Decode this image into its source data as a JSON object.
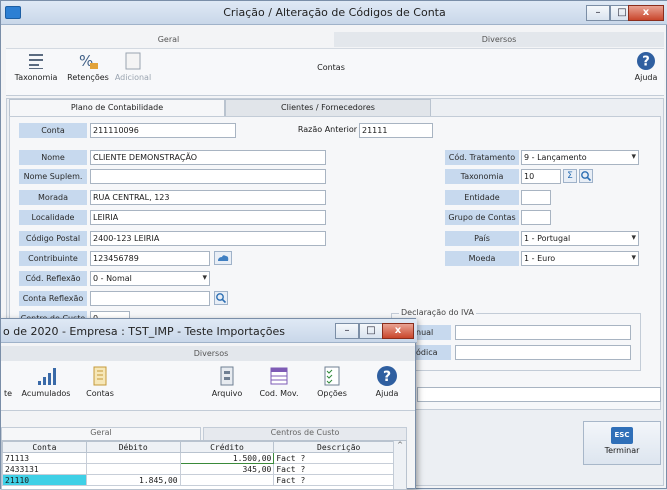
{
  "main_window": {
    "title": "Criação / Alteração de Códigos de Conta",
    "buttons": {
      "minimize": "–",
      "maximize": "□",
      "close": "x"
    },
    "ribbon_tabs": [
      "Geral",
      "Diversos"
    ],
    "ribbon_buttons": [
      {
        "label": "Taxonomia",
        "icon": "list-icon"
      },
      {
        "label": "Retenções",
        "icon": "percent-icon"
      },
      {
        "label": "Adicional",
        "icon": "blank-doc-icon"
      }
    ],
    "ribbon_center_label": "Contas",
    "help_label": "Ajuda",
    "tabs": [
      "Plano de Contabilidade",
      "Clientes / Fornecedores"
    ],
    "fields": {
      "conta": {
        "label": "Conta",
        "value": "211110096"
      },
      "razao_anterior": {
        "label": "Razão Anterior",
        "value": "21111"
      },
      "nome": {
        "label": "Nome",
        "value": "CLIENTE DEMONSTRAÇÃO"
      },
      "nome_suplem": {
        "label": "Nome Suplem.",
        "value": ""
      },
      "morada": {
        "label": "Morada",
        "value": "RUA CENTRAL, 123"
      },
      "localidade": {
        "label": "Localidade",
        "value": "LEIRIA"
      },
      "codigo_postal": {
        "label": "Código Postal",
        "value": "2400-123 LEIRIA"
      },
      "contribuinte": {
        "label": "Contribuinte",
        "value": "123456789"
      },
      "cod_reflexao": {
        "label": "Cód. Reflexão",
        "value": "0 - Nomal"
      },
      "conta_reflexao": {
        "label": "Conta Reflexão",
        "value": ""
      },
      "centro_custo": {
        "label": "Centro de Custo",
        "value": "0"
      },
      "cod_tratamento": {
        "label": "Cód. Tratamento",
        "value": "9 - Lançamento"
      },
      "taxonomia": {
        "label": "Taxonomia",
        "value": "10"
      },
      "entidade": {
        "label": "Entidade",
        "value": ""
      },
      "grupo_contas": {
        "label": "Grupo de Contas",
        "value": ""
      },
      "pais": {
        "label": "País",
        "value": "1 - Portugal"
      },
      "moeda": {
        "label": "Moeda",
        "value": "1 - Euro"
      }
    },
    "iva_group": {
      "title": "Declaração do IVA",
      "mensal": "nual",
      "periodica": "ódica"
    },
    "terminar": {
      "key": "ESC",
      "label": "Terminar"
    }
  },
  "secondary_window": {
    "title": "o de 2020 - Empresa : TST_IMP - Teste Importações",
    "ribbon_tab": "Diversos",
    "buttons": [
      {
        "label": "te",
        "icon": "partial-icon"
      },
      {
        "label": "Acumulados",
        "icon": "bar-chart-icon"
      },
      {
        "label": "Contas",
        "icon": "ledger-icon"
      },
      {
        "label": "Arquivo",
        "icon": "archive-icon"
      },
      {
        "label": "Cod. Mov.",
        "icon": "table-icon"
      },
      {
        "label": "Opções",
        "icon": "checklist-icon"
      },
      {
        "label": "Ajuda",
        "icon": "help-icon"
      }
    ],
    "subtabs": [
      "Geral",
      "Centros de Custo"
    ],
    "columns": [
      "Conta",
      "Débito",
      "Crédito",
      "Descrição"
    ],
    "rows": [
      {
        "conta": "71113",
        "debito": "",
        "credito": "1.500,00",
        "descricao": "Fact ?"
      },
      {
        "conta": "2433131",
        "debito": "",
        "credito": "345,00",
        "descricao": "Fact ?"
      },
      {
        "conta": "21110",
        "debito": "1.845,00",
        "credito": "",
        "descricao": "Fact ?"
      }
    ]
  },
  "colors": {
    "label_bg": "#c7d9ee",
    "accent": "#2d7fd3",
    "close": "#c9462c",
    "highlight_row": "#3fd0e6"
  }
}
